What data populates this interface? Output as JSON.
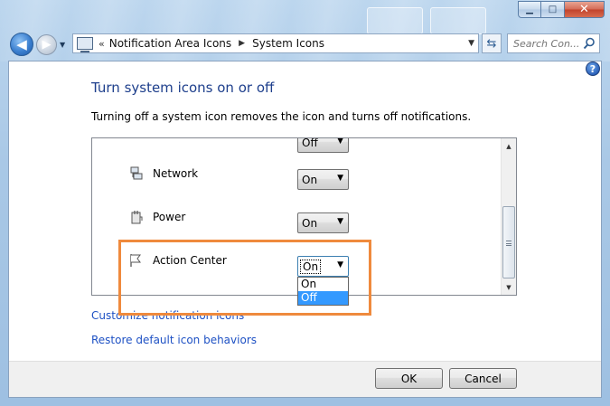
{
  "window": {
    "caption_buttons": {
      "minimize": "▁",
      "maximize": "□",
      "close": "✕"
    }
  },
  "nav": {
    "back_glyph": "◀",
    "forward_glyph": "▶",
    "address": {
      "separator": "«",
      "crumbs": [
        "Notification Area Icons",
        "System Icons"
      ]
    },
    "search_placeholder": "Search Con..."
  },
  "main": {
    "help_glyph": "?",
    "title": "Turn system icons on or off",
    "description": "Turning off a system icon removes the icon and turns off notifications.",
    "list": {
      "rows": [
        {
          "label": "",
          "value": "Off",
          "icon": "clipped-icon"
        },
        {
          "label": "Network",
          "value": "On",
          "icon": "network-icon"
        },
        {
          "label": "Power",
          "value": "On",
          "icon": "power-icon"
        },
        {
          "label": "Action Center",
          "value": "On",
          "icon": "flag-icon"
        }
      ],
      "open_dropdown": {
        "options": [
          "On",
          "Off"
        ],
        "highlighted": "Off"
      }
    },
    "links": {
      "customize": "Customize notification icons",
      "restore": "Restore default icon behaviors"
    }
  },
  "footer": {
    "ok_label": "OK",
    "cancel_label": "Cancel"
  },
  "colors": {
    "title_blue": "#1e3f8c",
    "link_blue": "#1e51c4",
    "highlight_orange": "#ef8a3d",
    "selection_blue": "#3399ff"
  }
}
